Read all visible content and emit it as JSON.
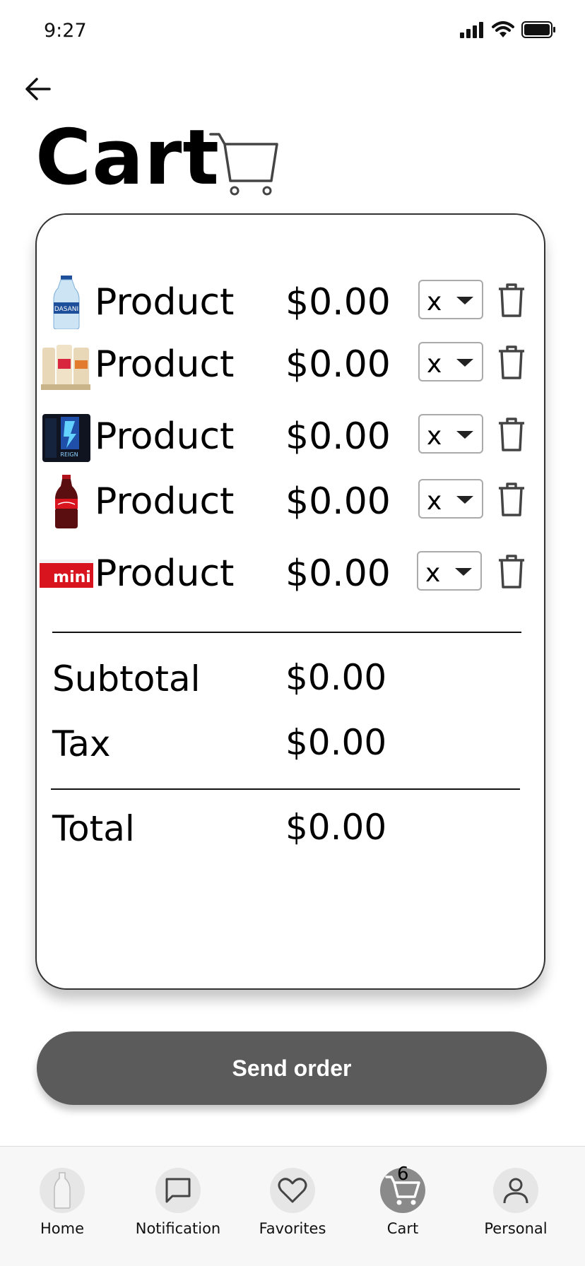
{
  "status_bar": {
    "time": "9:27"
  },
  "header": {
    "title": "Cart"
  },
  "items": [
    {
      "thumbnail": "water-bottle",
      "name": "Product",
      "price": "$0.00",
      "qty": "x"
    },
    {
      "thumbnail": "coffee-drink-pack",
      "name": "Product",
      "price": "$0.00",
      "qty": "x"
    },
    {
      "thumbnail": "energy-drink-box",
      "name": "Product",
      "price": "$0.00",
      "qty": "x"
    },
    {
      "thumbnail": "cola-bottle",
      "name": "Product",
      "price": "$0.00",
      "qty": "x"
    },
    {
      "thumbnail": "mini-can-pack",
      "name": "Product",
      "price": "$0.00",
      "qty": "x"
    }
  ],
  "summary": {
    "subtotal_label": "Subtotal",
    "subtotal_value": "$0.00",
    "tax_label": "Tax",
    "tax_value": "$0.00",
    "total_label": "Total",
    "total_value": "$0.00"
  },
  "actions": {
    "send_order": "Send order"
  },
  "tabbar": {
    "tabs": [
      {
        "label": "Home",
        "icon": "bottle-icon"
      },
      {
        "label": "Notification",
        "icon": "chat-bubble-icon"
      },
      {
        "label": "Favorites",
        "icon": "heart-icon"
      },
      {
        "label": "Cart",
        "icon": "cart-icon",
        "badge": "6",
        "active": true
      },
      {
        "label": "Personal",
        "icon": "person-icon"
      }
    ]
  },
  "colors": {
    "button": "#5b5b5b",
    "active_tab": "#8a8a8a",
    "tab_bg": "#f7f7f7"
  }
}
